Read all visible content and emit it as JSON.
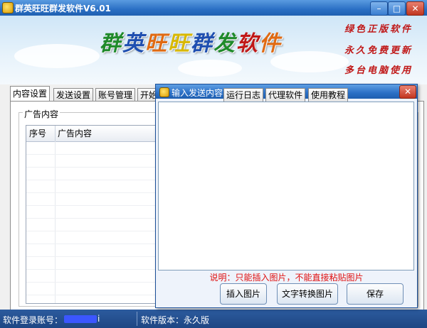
{
  "window": {
    "title": "群英旺旺群发软件V6.01",
    "controls": {
      "minimize": "–",
      "maximize": "□",
      "close": "✕"
    }
  },
  "banner": {
    "title_chars": [
      "群",
      "英",
      "旺",
      "旺",
      "群",
      "发",
      "软",
      "件"
    ],
    "title_colors": [
      "#1f8a2a",
      "#1f4fb0",
      "#e06a12",
      "#d8b800",
      "#1f4fb0",
      "#1f8a2a",
      "#c01818",
      "#e06a12"
    ],
    "slogans": [
      "绿色正版软件",
      "永久免费更新",
      "多台电脑使用"
    ]
  },
  "tabs": {
    "content": "内容设置",
    "send": "发送设置",
    "account": "账号管理",
    "start": "开始",
    "log": "运行日志",
    "agent": "代理软件",
    "help": "使用教程"
  },
  "ad_group": {
    "label": "广告内容",
    "columns": [
      "序号",
      "广告内容"
    ]
  },
  "status": {
    "account_label": "软件登录账号：",
    "account_value_tail": "i",
    "version": "软件版本：永久版"
  },
  "dialog": {
    "title": "输入发送内容",
    "close": "✕",
    "note": "说明：只能插入图片，不能直接粘贴图片",
    "buttons": {
      "insert_image": "插入图片",
      "text_to_image": "文字转换图片",
      "save": "保存"
    }
  },
  "colors": {
    "accent": "#2a6fc4",
    "note_red": "#e01010",
    "slogan_red": "#c01818"
  }
}
